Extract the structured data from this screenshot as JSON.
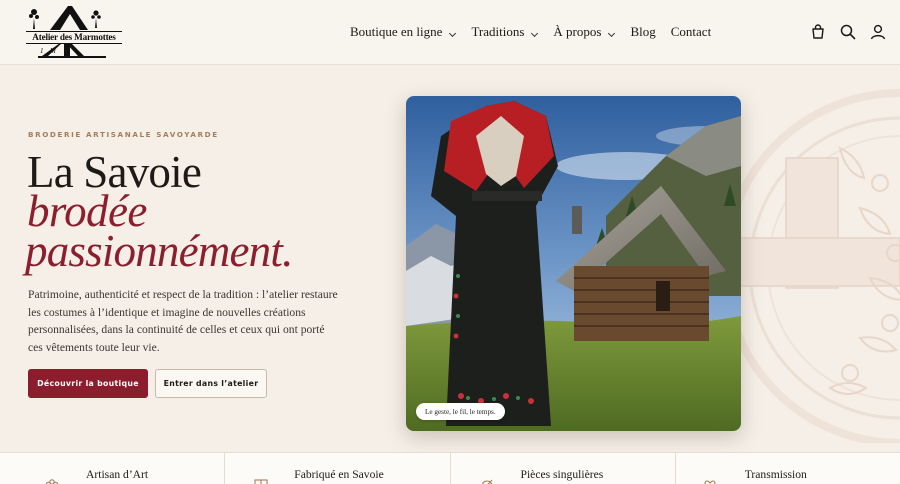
{
  "brand": {
    "name": "Atelier des Marmottes"
  },
  "nav": {
    "items": [
      {
        "label": "Boutique en ligne",
        "dropdown": true
      },
      {
        "label": "Traditions",
        "dropdown": true
      },
      {
        "label": "À propos",
        "dropdown": true
      },
      {
        "label": "Blog",
        "dropdown": false
      },
      {
        "label": "Contact",
        "dropdown": false
      }
    ],
    "icons": [
      "shopping-bag-icon",
      "search-icon",
      "user-icon"
    ]
  },
  "hero": {
    "eyebrow": "BRODERIE ARTISANALE SAVOYARDE",
    "title_line1": "La Savoie",
    "title_line2": "brodée",
    "title_line3": "passionnément.",
    "lead": "Patrimoine, authenticité et respect de la tradition : l’atelier restaure les costumes à l’identique et imagine de nouvelles créations personnalisées, dans la continuité de celles et ceux qui ont porté ces vêtements toute leur vie.",
    "primary_cta": "Découvrir la boutique",
    "secondary_cta": "Entrer dans l’atelier",
    "image_caption": "Le geste, le fil, le temps."
  },
  "features": [
    {
      "label": "Artisan d’Art",
      "icon": "flower-icon"
    },
    {
      "label": "Fabriqué en Savoie",
      "icon": "savoie-flag-icon"
    },
    {
      "label": "Pièces singulières",
      "icon": "needle-icon"
    },
    {
      "label": "Transmission",
      "icon": "heart-hands-icon"
    }
  ],
  "colors": {
    "accent": "#8b1d2c",
    "eyebrow": "#a47e5a",
    "background": "#f5efe7"
  }
}
